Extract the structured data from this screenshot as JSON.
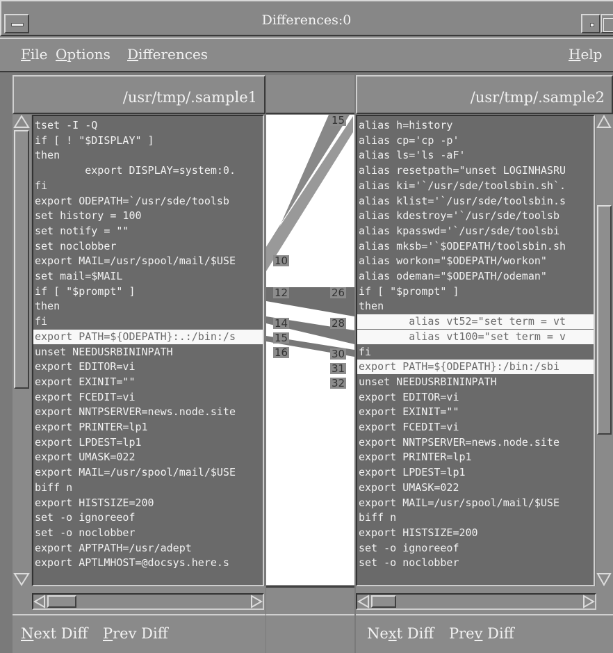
{
  "window": {
    "title": "Differences:0"
  },
  "menu": [
    {
      "label": "File",
      "mnemonic": "F",
      "rest": "ile"
    },
    {
      "label": "Options",
      "mnemonic": "O",
      "rest": "ptions"
    },
    {
      "label": "Differences",
      "mnemonic": "D",
      "rest": "ifferences"
    },
    {
      "label": "Help",
      "mnemonic": "H",
      "rest": "elp"
    }
  ],
  "left": {
    "path": "/usr/tmp/.sample1",
    "lines": [
      "tset -I -Q",
      "if [ ! \"$DISPLAY\" ]",
      "then",
      "        export DISPLAY=system:0.",
      "fi",
      "export ODEPATH=`/usr/sde/toolsb",
      "set history = 100",
      "set notify = \"\"",
      "set noclobber",
      "export MAIL=/usr/spool/mail/$USE",
      "set mail=$MAIL",
      "if [ \"$prompt\" ]",
      "then",
      "fi",
      "export PATH=${ODEPATH}:.:/bin:/s",
      "unset NEEDUSRBININPATH",
      "export EDITOR=vi",
      "export EXINIT=\"\"",
      "export FCEDIT=vi",
      "export NNTPSERVER=news.node.site",
      "export PRINTER=lp1",
      "export LPDEST=lp1",
      "export UMASK=022",
      "export MAIL=/usr/spool/mail/$USE",
      "biff n",
      "export HISTSIZE=200",
      "set -o ignoreeof",
      "set -o noclobber",
      "export APTPATH=/usr/adept",
      "export APTLMHOST=@docsys.here.s"
    ]
  },
  "right": {
    "path": "/usr/tmp/.sample2",
    "lines": [
      "alias h=history",
      "alias cp='cp -p'",
      "alias ls='ls -aF'",
      "alias resetpath=\"unset LOGINHASRU",
      "alias ki='`/usr/sde/toolsbin.sh`.",
      "alias klist='`/usr/sde/toolsbin.s",
      "alias kdestroy='`/usr/sde/toolsb",
      "alias kpasswd='`/usr/sde/toolsbi",
      "alias mksb='`$ODEPATH/toolsbin.sh",
      "alias workon=\"$ODEPATH/workon\"",
      "alias odeman=\"$ODEPATH/odeman\"",
      "if [ \"$prompt\" ]",
      "then",
      "        alias vt52=\"set term = vt",
      "        alias vt100=\"set term = v",
      "fi",
      "export PATH=${ODEPATH}:/bin:/sbi",
      "unset NEEDUSRBININPATH",
      "export EDITOR=vi",
      "export EXINIT=\"\"",
      "export FCEDIT=vi",
      "export NNTPSERVER=news.node.site",
      "export PRINTER=lp1",
      "export LPDEST=lp1",
      "export UMASK=022",
      "export MAIL=/usr/spool/mail/$USE",
      "biff n",
      "export HISTSIZE=200",
      "set -o ignoreeof",
      "set -o noclobber"
    ]
  },
  "gutter": {
    "left_numbers": [
      "10",
      "12",
      "14",
      "15",
      "16"
    ],
    "right_numbers": [
      "15",
      "26",
      "28",
      "30",
      "31",
      "32"
    ]
  },
  "buttons": {
    "left": [
      {
        "label": "Next Diff",
        "mnemonic": "N",
        "rest": "ext Diff"
      },
      {
        "label": "Prev Diff",
        "mnemonic": "P",
        "rest": "rev Diff"
      }
    ],
    "right": [
      {
        "label": "Next Diff",
        "pre": "Ne",
        "mnemonic": "x",
        "rest": "t Diff"
      },
      {
        "label": "Prev Diff",
        "pre": "Pre",
        "mnemonic": "v",
        "rest": " Diff"
      }
    ]
  }
}
